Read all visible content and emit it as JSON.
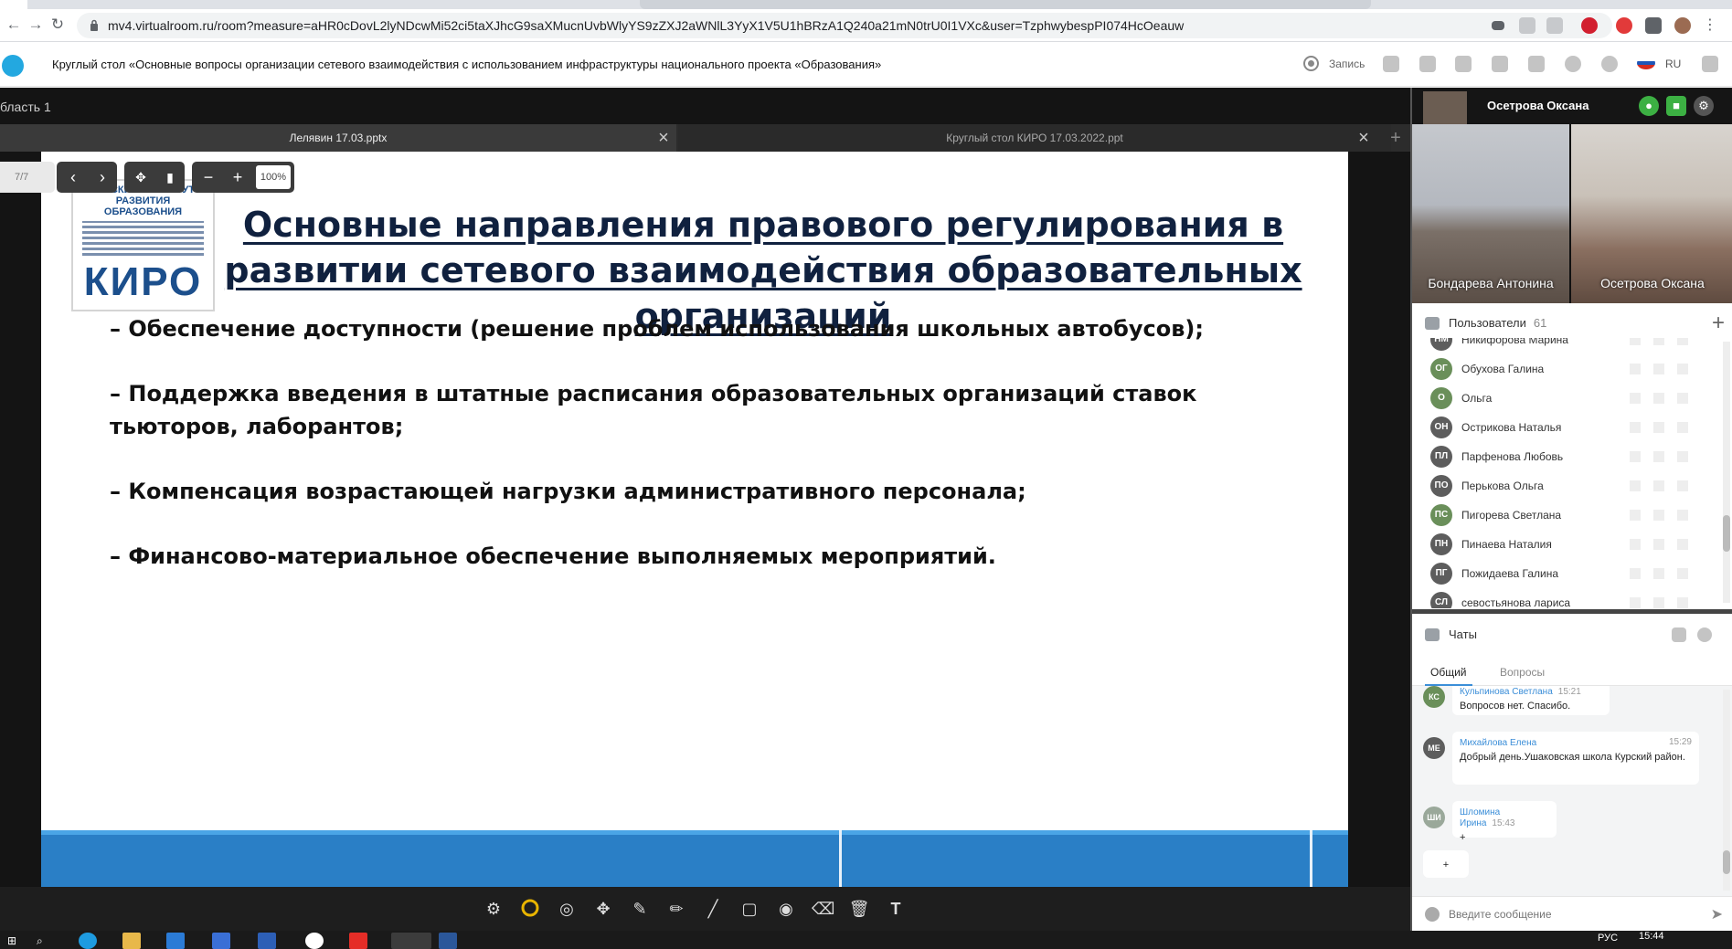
{
  "browser": {
    "url": "mv4.virtualroom.ru/room?measure=aHR0cDovL2lyNDcwMi52ci5taXJhcG9saXMucnUvbWlyYS9zZXJ2aWNlL3YyX1V5U1hBRzA1Q240a21mN0trU0I1VXc&user=TzphwybespPI074HcOeauw",
    "back": "←",
    "forward": "→",
    "reload": "↻"
  },
  "header": {
    "title": "Круглый стол «Основные вопросы организации сетевого взаимодействия с использованием инфраструктуры национального проекта «Образования»",
    "record_label": "Запись",
    "language": "RU"
  },
  "presentation": {
    "area_title": "бласть 1",
    "tabs": [
      {
        "label": "Лелявин 17.03.pptx"
      },
      {
        "label": "Круглый стол КИРО 17.03.2022.ppt"
      }
    ],
    "page": "7/7",
    "zoom": "100%",
    "slide": {
      "logo_line1": "КУРСКИЙ ИНСТИТУТ",
      "logo_line2": "РАЗВИТИЯ ОБРАЗОВАНИЯ",
      "logo_mark": "КИРО",
      "title": "Основные направления правового регулирования в развитии сетевого взаимодействия образовательных организаций",
      "bullets": [
        "– Обеспечение доступности (решение проблем использования школьных автобусов);",
        "– Поддержка введения в штатные расписания образовательных организаций ставок тьюторов, лаборантов;",
        "– Компенсация возрастающей нагрузки административного персонала;",
        "– Финансово-материальное обеспечение выполняемых мероприятий."
      ]
    }
  },
  "sidebar": {
    "speaker_name": "Осетрова Оксана",
    "video_tiles": [
      {
        "name": "Бондарева Антонина"
      },
      {
        "name": "Осетрова Оксана"
      }
    ],
    "users_title": "Пользователи",
    "users_count": "61",
    "users": [
      {
        "initials": "НМ",
        "name": "Никифорова Марина",
        "color": "#5d5d5d"
      },
      {
        "initials": "ОГ",
        "name": "Обухова Галина",
        "color": "#6a8f5a"
      },
      {
        "initials": "О",
        "name": "Ольга",
        "color": "#6a8f5a"
      },
      {
        "initials": "ОН",
        "name": "Острикова Наталья",
        "color": "#5d5d5d"
      },
      {
        "initials": "ПЛ",
        "name": "Парфенова Любовь",
        "color": "#5d5d5d"
      },
      {
        "initials": "ПО",
        "name": "Перькова Ольга",
        "color": "#5d5d5d"
      },
      {
        "initials": "ПС",
        "name": "Пигорева Светлана",
        "color": "#6a8f5a"
      },
      {
        "initials": "ПН",
        "name": "Пинаева Наталия",
        "color": "#5d5d5d"
      },
      {
        "initials": "ПГ",
        "name": "Пожидаева Галина",
        "color": "#5d5d5d"
      },
      {
        "initials": "СЛ",
        "name": "севостьянова лариса",
        "color": "#5d5d5d"
      }
    ],
    "chats_title": "Чаты",
    "chat_tabs": [
      "Общий",
      "Вопросы"
    ],
    "messages": [
      {
        "initials": "КС",
        "author": "Кульпинова Светлана",
        "time": "15:21",
        "text": "Вопросов нет. Спасибо.",
        "color": "#6a8f5a"
      },
      {
        "initials": "МЕ",
        "author": "Михайлова Елена",
        "time": "15:29",
        "text": "Добрый день.Ушаковская школа Курский район.",
        "color": "#5d5d5d"
      },
      {
        "initials": "ШИ",
        "author": "Шломина Ирина",
        "time": "15:43",
        "text": "+",
        "color": "#9aa89a"
      },
      {
        "initials": "",
        "author": "",
        "time": "",
        "text": "+",
        "color": "#ffffff"
      }
    ],
    "input_placeholder": "Введите сообщение"
  },
  "taskbar": {
    "keyboard": "РУС",
    "clock": "15:44"
  }
}
